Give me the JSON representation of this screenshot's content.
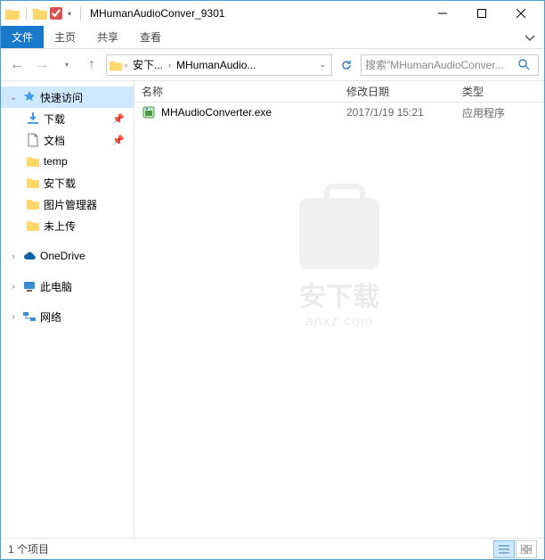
{
  "title": "MHumanAudioConver_9301",
  "ribbon": {
    "file": "文件",
    "home": "主页",
    "share": "共享",
    "view": "查看"
  },
  "breadcrumb": {
    "c1": "安下...",
    "c2": "MHumanAudio..."
  },
  "search": {
    "placeholder": "搜索\"MHumanAudioConver..."
  },
  "sidebar": {
    "quick": "快速访问",
    "downloads": "下载",
    "documents": "文档",
    "temp": "temp",
    "anxz": "安下载",
    "picmgr": "图片管理器",
    "noupload": "未上传",
    "onedrive": "OneDrive",
    "thispc": "此电脑",
    "network": "网络"
  },
  "columns": {
    "name": "名称",
    "date": "修改日期",
    "type": "类型"
  },
  "files": [
    {
      "name": "MHAudioConverter.exe",
      "date": "2017/1/19 15:21",
      "type": "应用程序"
    }
  ],
  "status": {
    "count": "1 个项目"
  },
  "watermark": {
    "t1": "安下载",
    "t2": "anxz.com"
  }
}
